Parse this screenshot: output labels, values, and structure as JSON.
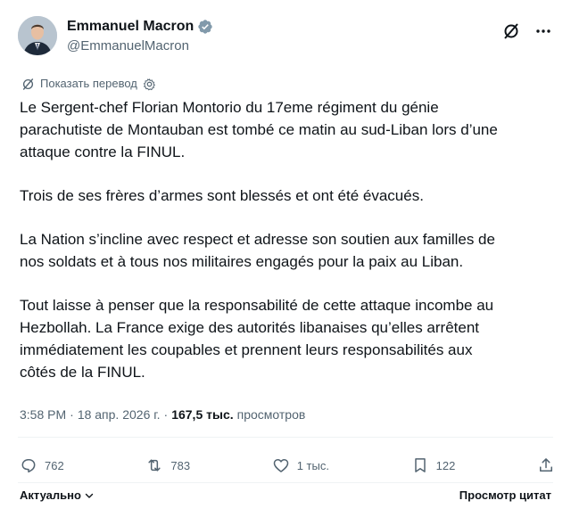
{
  "author": {
    "name": "Emmanuel Macron",
    "handle": "@EmmanuelMacron"
  },
  "icons": {
    "verified": "verified-badge-icon",
    "grok": "grok-icon",
    "more": "more-icon",
    "translate": "translate-icon",
    "settings": "gear-icon",
    "reply": "reply-icon",
    "retweet": "retweet-icon",
    "like": "heart-icon",
    "bookmark": "bookmark-icon",
    "share": "share-icon"
  },
  "translate": {
    "label": "Показать перевод"
  },
  "tweet": {
    "paragraphs": [
      "Le Sergent-chef Florian Montorio du 17eme régiment du génie\nparachutiste de Montauban est tombé ce matin au sud-Liban lors d’une\nattaque contre la FINUL.",
      "Trois de ses frères d’armes sont blessés et ont été évacués.",
      "La Nation s’incline avec respect et adresse son soutien aux familles de\nnos soldats et à tous nos militaires engagés pour la paix au Liban.",
      "Tout laisse à penser que la responsabilité de cette attaque incombe au\nHezbollah. La France exige des autorités libanaises qu’elles arrêtent\nimmédiatement les coupables et prennent leurs responsabilités aux\ncôtés de la FINUL."
    ],
    "time": "3:58 PM",
    "date": "18 апр. 2026 г.",
    "views_count": "167,5 тыс.",
    "views_label": "просмотров"
  },
  "actions": {
    "replies": "762",
    "retweets": "783",
    "likes": "1 тыс.",
    "bookmarks": "122"
  },
  "footer": {
    "sort_label": "Актуально",
    "quotes_label": "Просмотр цитат"
  },
  "colors": {
    "text": "#0f1419",
    "muted": "#536471",
    "verified": "#829aab",
    "divider": "#eff3f4"
  }
}
